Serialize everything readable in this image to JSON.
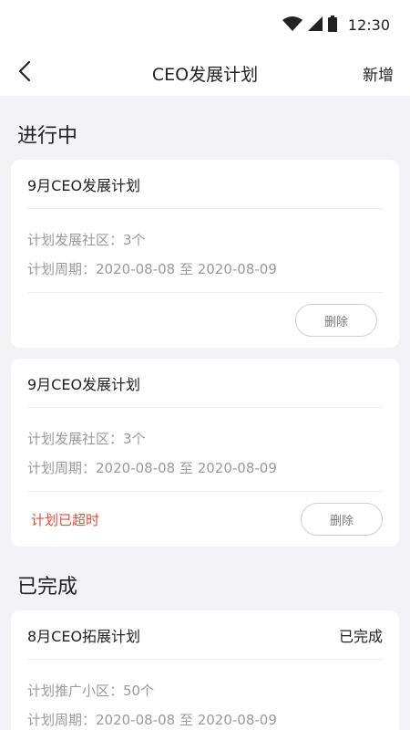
{
  "status_bar": {
    "time": "12:30"
  },
  "nav": {
    "title": "CEO发展计划",
    "action": "新增"
  },
  "sections": [
    {
      "title": "进行中"
    },
    {
      "title": "已完成"
    }
  ],
  "cards": [
    {
      "title": "9月CEO发展计划",
      "community_label": "计划发展社区：",
      "community_value": "3个",
      "period_label": "计划周期：",
      "period_value": "2020-08-08 至 2020-08-09",
      "delete_label": "删除"
    },
    {
      "title": "9月CEO发展计划",
      "community_label": "计划发展社区：",
      "community_value": "3个",
      "period_label": "计划周期：",
      "period_value": "2020-08-08 至 2020-08-09",
      "warning": "计划已超时",
      "delete_label": "删除"
    },
    {
      "title": "8月CEO拓展计划",
      "status": "已完成",
      "community_label": "计划推广小区：",
      "community_value": "50个",
      "period_label": "计划周期：",
      "period_value": "2020-08-08 至 2020-08-09"
    }
  ],
  "colors": {
    "background": "#f3f2f6",
    "warning": "#e84a3c",
    "muted_text": "#9a9a9a"
  }
}
